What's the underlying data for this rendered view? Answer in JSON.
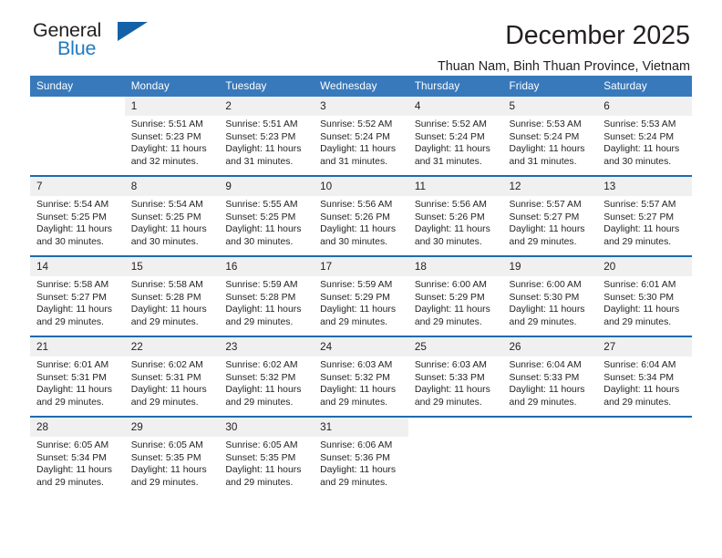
{
  "logo": {
    "word1": "General",
    "word2": "Blue",
    "triangle_color": "#1461a8",
    "blue_color": "#1f7ac1"
  },
  "header": {
    "title": "December 2025",
    "subtitle": "Thuan Nam, Binh Thuan Province, Vietnam"
  },
  "theme": {
    "header_bg": "#3879bb",
    "week_separator": "#1f6bb0",
    "daynum_bg": "#f0f0f0",
    "text": "#231f20"
  },
  "calendar": {
    "weekday_headers": [
      "Sunday",
      "Monday",
      "Tuesday",
      "Wednesday",
      "Thursday",
      "Friday",
      "Saturday"
    ],
    "weeks": [
      {
        "days": [
          {
            "num": "",
            "sunrise": "",
            "sunset": "",
            "daylight1": "",
            "daylight2": ""
          },
          {
            "num": "1",
            "sunrise": "Sunrise: 5:51 AM",
            "sunset": "Sunset: 5:23 PM",
            "daylight1": "Daylight: 11 hours",
            "daylight2": "and 32 minutes."
          },
          {
            "num": "2",
            "sunrise": "Sunrise: 5:51 AM",
            "sunset": "Sunset: 5:23 PM",
            "daylight1": "Daylight: 11 hours",
            "daylight2": "and 31 minutes."
          },
          {
            "num": "3",
            "sunrise": "Sunrise: 5:52 AM",
            "sunset": "Sunset: 5:24 PM",
            "daylight1": "Daylight: 11 hours",
            "daylight2": "and 31 minutes."
          },
          {
            "num": "4",
            "sunrise": "Sunrise: 5:52 AM",
            "sunset": "Sunset: 5:24 PM",
            "daylight1": "Daylight: 11 hours",
            "daylight2": "and 31 minutes."
          },
          {
            "num": "5",
            "sunrise": "Sunrise: 5:53 AM",
            "sunset": "Sunset: 5:24 PM",
            "daylight1": "Daylight: 11 hours",
            "daylight2": "and 31 minutes."
          },
          {
            "num": "6",
            "sunrise": "Sunrise: 5:53 AM",
            "sunset": "Sunset: 5:24 PM",
            "daylight1": "Daylight: 11 hours",
            "daylight2": "and 30 minutes."
          }
        ]
      },
      {
        "days": [
          {
            "num": "7",
            "sunrise": "Sunrise: 5:54 AM",
            "sunset": "Sunset: 5:25 PM",
            "daylight1": "Daylight: 11 hours",
            "daylight2": "and 30 minutes."
          },
          {
            "num": "8",
            "sunrise": "Sunrise: 5:54 AM",
            "sunset": "Sunset: 5:25 PM",
            "daylight1": "Daylight: 11 hours",
            "daylight2": "and 30 minutes."
          },
          {
            "num": "9",
            "sunrise": "Sunrise: 5:55 AM",
            "sunset": "Sunset: 5:25 PM",
            "daylight1": "Daylight: 11 hours",
            "daylight2": "and 30 minutes."
          },
          {
            "num": "10",
            "sunrise": "Sunrise: 5:56 AM",
            "sunset": "Sunset: 5:26 PM",
            "daylight1": "Daylight: 11 hours",
            "daylight2": "and 30 minutes."
          },
          {
            "num": "11",
            "sunrise": "Sunrise: 5:56 AM",
            "sunset": "Sunset: 5:26 PM",
            "daylight1": "Daylight: 11 hours",
            "daylight2": "and 30 minutes."
          },
          {
            "num": "12",
            "sunrise": "Sunrise: 5:57 AM",
            "sunset": "Sunset: 5:27 PM",
            "daylight1": "Daylight: 11 hours",
            "daylight2": "and 29 minutes."
          },
          {
            "num": "13",
            "sunrise": "Sunrise: 5:57 AM",
            "sunset": "Sunset: 5:27 PM",
            "daylight1": "Daylight: 11 hours",
            "daylight2": "and 29 minutes."
          }
        ]
      },
      {
        "days": [
          {
            "num": "14",
            "sunrise": "Sunrise: 5:58 AM",
            "sunset": "Sunset: 5:27 PM",
            "daylight1": "Daylight: 11 hours",
            "daylight2": "and 29 minutes."
          },
          {
            "num": "15",
            "sunrise": "Sunrise: 5:58 AM",
            "sunset": "Sunset: 5:28 PM",
            "daylight1": "Daylight: 11 hours",
            "daylight2": "and 29 minutes."
          },
          {
            "num": "16",
            "sunrise": "Sunrise: 5:59 AM",
            "sunset": "Sunset: 5:28 PM",
            "daylight1": "Daylight: 11 hours",
            "daylight2": "and 29 minutes."
          },
          {
            "num": "17",
            "sunrise": "Sunrise: 5:59 AM",
            "sunset": "Sunset: 5:29 PM",
            "daylight1": "Daylight: 11 hours",
            "daylight2": "and 29 minutes."
          },
          {
            "num": "18",
            "sunrise": "Sunrise: 6:00 AM",
            "sunset": "Sunset: 5:29 PM",
            "daylight1": "Daylight: 11 hours",
            "daylight2": "and 29 minutes."
          },
          {
            "num": "19",
            "sunrise": "Sunrise: 6:00 AM",
            "sunset": "Sunset: 5:30 PM",
            "daylight1": "Daylight: 11 hours",
            "daylight2": "and 29 minutes."
          },
          {
            "num": "20",
            "sunrise": "Sunrise: 6:01 AM",
            "sunset": "Sunset: 5:30 PM",
            "daylight1": "Daylight: 11 hours",
            "daylight2": "and 29 minutes."
          }
        ]
      },
      {
        "days": [
          {
            "num": "21",
            "sunrise": "Sunrise: 6:01 AM",
            "sunset": "Sunset: 5:31 PM",
            "daylight1": "Daylight: 11 hours",
            "daylight2": "and 29 minutes."
          },
          {
            "num": "22",
            "sunrise": "Sunrise: 6:02 AM",
            "sunset": "Sunset: 5:31 PM",
            "daylight1": "Daylight: 11 hours",
            "daylight2": "and 29 minutes."
          },
          {
            "num": "23",
            "sunrise": "Sunrise: 6:02 AM",
            "sunset": "Sunset: 5:32 PM",
            "daylight1": "Daylight: 11 hours",
            "daylight2": "and 29 minutes."
          },
          {
            "num": "24",
            "sunrise": "Sunrise: 6:03 AM",
            "sunset": "Sunset: 5:32 PM",
            "daylight1": "Daylight: 11 hours",
            "daylight2": "and 29 minutes."
          },
          {
            "num": "25",
            "sunrise": "Sunrise: 6:03 AM",
            "sunset": "Sunset: 5:33 PM",
            "daylight1": "Daylight: 11 hours",
            "daylight2": "and 29 minutes."
          },
          {
            "num": "26",
            "sunrise": "Sunrise: 6:04 AM",
            "sunset": "Sunset: 5:33 PM",
            "daylight1": "Daylight: 11 hours",
            "daylight2": "and 29 minutes."
          },
          {
            "num": "27",
            "sunrise": "Sunrise: 6:04 AM",
            "sunset": "Sunset: 5:34 PM",
            "daylight1": "Daylight: 11 hours",
            "daylight2": "and 29 minutes."
          }
        ]
      },
      {
        "days": [
          {
            "num": "28",
            "sunrise": "Sunrise: 6:05 AM",
            "sunset": "Sunset: 5:34 PM",
            "daylight1": "Daylight: 11 hours",
            "daylight2": "and 29 minutes."
          },
          {
            "num": "29",
            "sunrise": "Sunrise: 6:05 AM",
            "sunset": "Sunset: 5:35 PM",
            "daylight1": "Daylight: 11 hours",
            "daylight2": "and 29 minutes."
          },
          {
            "num": "30",
            "sunrise": "Sunrise: 6:05 AM",
            "sunset": "Sunset: 5:35 PM",
            "daylight1": "Daylight: 11 hours",
            "daylight2": "and 29 minutes."
          },
          {
            "num": "31",
            "sunrise": "Sunrise: 6:06 AM",
            "sunset": "Sunset: 5:36 PM",
            "daylight1": "Daylight: 11 hours",
            "daylight2": "and 29 minutes."
          },
          {
            "num": "",
            "sunrise": "",
            "sunset": "",
            "daylight1": "",
            "daylight2": ""
          },
          {
            "num": "",
            "sunrise": "",
            "sunset": "",
            "daylight1": "",
            "daylight2": ""
          },
          {
            "num": "",
            "sunrise": "",
            "sunset": "",
            "daylight1": "",
            "daylight2": ""
          }
        ]
      }
    ]
  }
}
